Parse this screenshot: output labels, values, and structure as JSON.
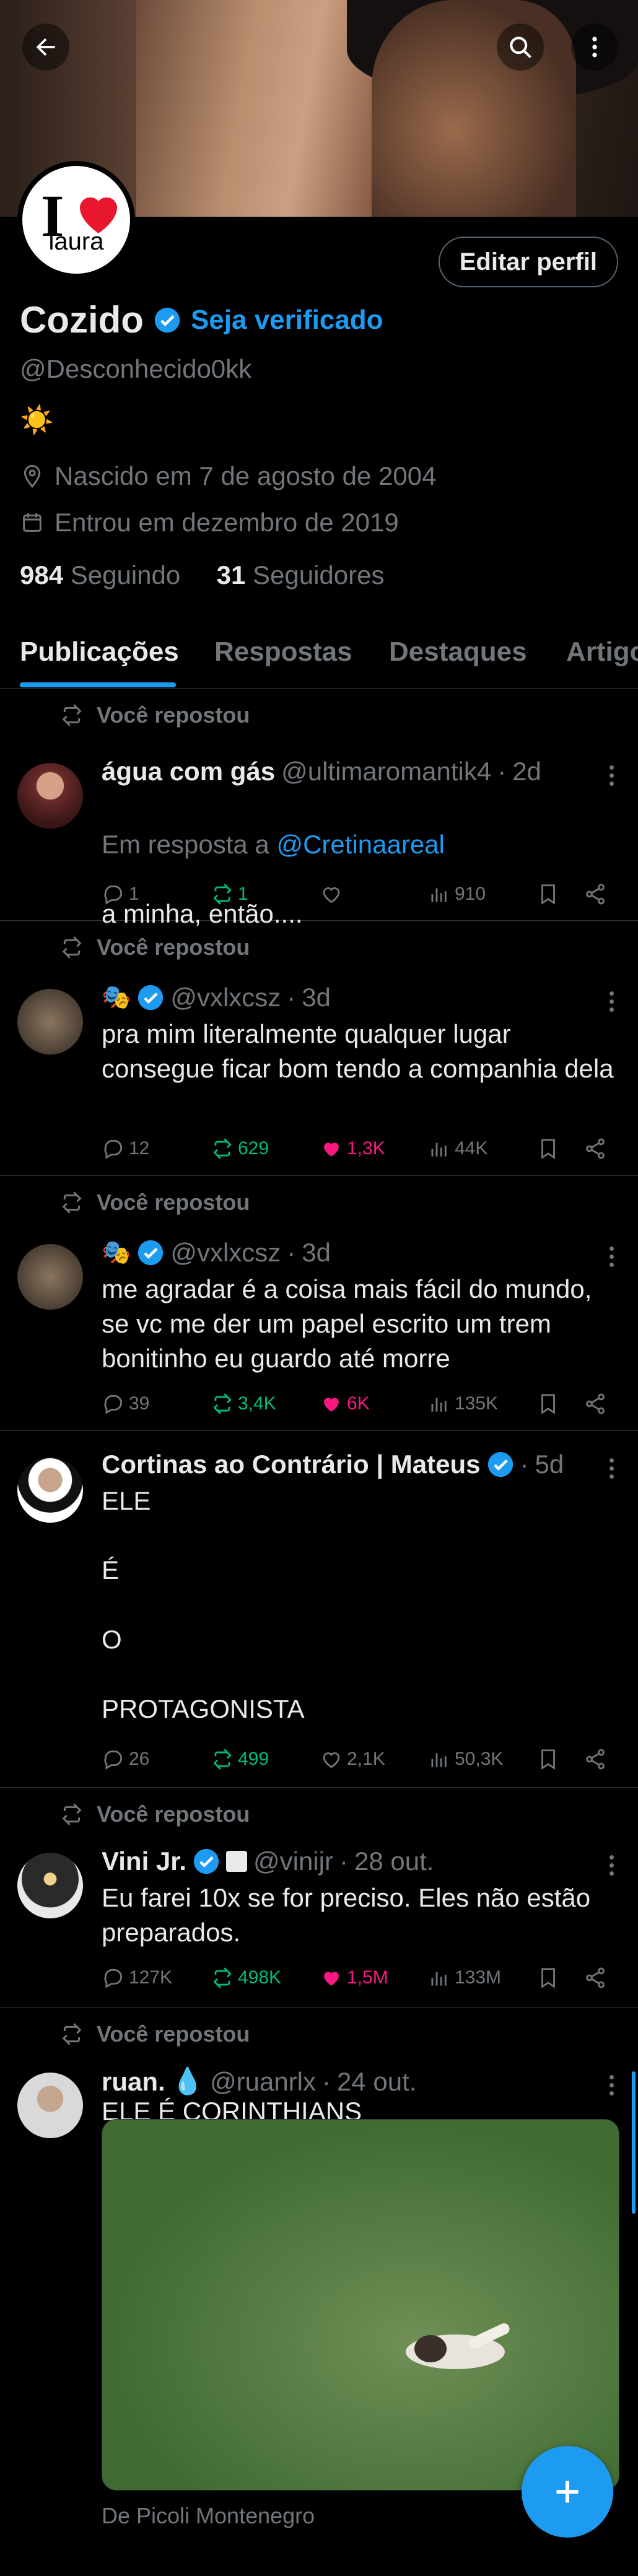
{
  "profile": {
    "avatar_name": "laura",
    "display_name": "Cozido",
    "verify_cta": "Seja verificado",
    "handle": "@Desconhecido0kk",
    "bio": "☀️",
    "birth": "Nascido em 7 de agosto de 2004",
    "joined": "Entrou em dezembro de 2019",
    "following_count": "984",
    "following_label": "Seguindo",
    "followers_count": "31",
    "followers_label": "Seguidores",
    "edit_label": "Editar perfil"
  },
  "tabs": [
    "Publicações",
    "Respostas",
    "Destaques",
    "Artigos"
  ],
  "repost_label": "Você repostou",
  "posts": [
    {
      "name": "água com gás",
      "handle": "@ultimaromantik4",
      "time": "2d",
      "reply_prefix": "Em resposta a",
      "reply_to": "@Cretinaareal",
      "text": "a minha, então....",
      "replies": "1",
      "reposts": "1",
      "likes": "",
      "views": "910"
    },
    {
      "name": "🎭",
      "handle": "@vxlxcsz",
      "time": "3d",
      "text": "pra mim literalmente qualquer lugar consegue ficar bom tendo a companhia dela",
      "replies": "12",
      "reposts": "629",
      "likes": "1,3K",
      "views": "44K"
    },
    {
      "name": "🎭",
      "handle": "@vxlxcsz",
      "time": "3d",
      "text": "me agradar é a coisa mais fácil do mundo, se vc me der um papel escrito um trem bonitinho eu guardo até morre",
      "replies": "39",
      "reposts": "3,4K",
      "likes": "6K",
      "views": "135K"
    },
    {
      "name": "Cortinas ao Contrário | Mateus",
      "time": "5d",
      "text": "ELE\n\nÉ\n\nO\n\nPROTAGONISTA",
      "replies": "26",
      "reposts": "499",
      "likes": "2,1K",
      "views": "50,3K"
    },
    {
      "name": "Vini Jr.",
      "handle": "@vinijr",
      "time": "28 out.",
      "text": "Eu farei 10x se for preciso. Eles não estão preparados.",
      "replies": "127K",
      "reposts": "498K",
      "likes": "1,5M",
      "views": "133M"
    },
    {
      "name": "ruan.",
      "handle": "@ruanrlx",
      "time": "24 out.",
      "text": "ELE É CORINTHIANS",
      "media_caption": "De Picoli Montenegro"
    }
  ],
  "colors": {
    "accent": "#1d9bf0",
    "repost": "#00ba7c",
    "like": "#f91880",
    "muted": "#71767b"
  },
  "icons": [
    "back-arrow-icon",
    "search-icon",
    "more-vertical-icon",
    "verified-badge-icon",
    "location-icon",
    "calendar-icon",
    "repost-icon",
    "reply-icon",
    "like-icon",
    "views-icon",
    "bookmark-icon",
    "share-icon",
    "compose-icon"
  ]
}
